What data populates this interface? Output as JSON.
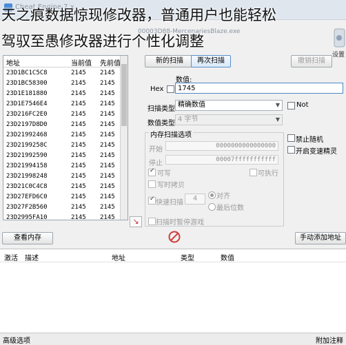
{
  "caption": {
    "line1": "天之痕数据惊现修改器，普通用户也能轻松",
    "line2": "驾驭至愚修改器进行个性化调整"
  },
  "window": {
    "app_title": "Cheat Engine 7.x",
    "process_title": "00003D88-MercenariesBlaze.exe"
  },
  "address_list": {
    "headers": [
      "地址",
      "当前值",
      "先前值"
    ],
    "rows": [
      {
        "address": "23D1BC1C5C8",
        "current": "2145",
        "previous": "2145"
      },
      {
        "address": "23D1BC58300",
        "current": "2145",
        "previous": "2145"
      },
      {
        "address": "23D1E181880",
        "current": "2145",
        "previous": "2145"
      },
      {
        "address": "23D1E7546E4",
        "current": "2145",
        "previous": "2145"
      },
      {
        "address": "23D216FC2E0",
        "current": "2145",
        "previous": "2145"
      },
      {
        "address": "23D2197D8D0",
        "current": "2145",
        "previous": "2145"
      },
      {
        "address": "23D21992468",
        "current": "2145",
        "previous": "2145"
      },
      {
        "address": "23D2199258C",
        "current": "2145",
        "previous": "2145"
      },
      {
        "address": "23D21992590",
        "current": "2145",
        "previous": "2145"
      },
      {
        "address": "23D21994158",
        "current": "2145",
        "previous": "2145"
      },
      {
        "address": "23D21998248",
        "current": "2145",
        "previous": "2145"
      },
      {
        "address": "23D21C0C4C8",
        "current": "2145",
        "previous": "2145"
      },
      {
        "address": "23D27EFD6C0",
        "current": "2145",
        "previous": "2145"
      },
      {
        "address": "23D27F2B560",
        "current": "2145",
        "previous": "2145"
      },
      {
        "address": "23D2995FA10",
        "current": "2145",
        "previous": "2145"
      }
    ]
  },
  "scan": {
    "new_scan": "新的扫描",
    "next_scan": "再次扫描",
    "undo_scan": "撤销扫描",
    "settings": "设置",
    "value_label": "数值:",
    "hex_label": "Hex",
    "value": "1745",
    "scan_type_label": "扫描类型",
    "scan_type": "精确数值",
    "value_type_label": "数值类型",
    "value_type": "4 字节",
    "not_label": "Not",
    "no_random": "禁止随机",
    "speedhack": "开启变速精灵"
  },
  "memory_options": {
    "title": "内存扫描选项",
    "start_label": "开始",
    "start_value": "0000000000000000",
    "stop_label": "停止",
    "stop_value": "00007fffffffffff",
    "writable": "可写",
    "executable": "可执行",
    "copy_on_write": "写时拷贝",
    "fast_scan": "快速扫描",
    "fast_scan_value": "4",
    "align": "对齐",
    "last_digits": "最后位数",
    "pause_game": "扫描时暂停游戏"
  },
  "toolbar": {
    "view_memory": "查看内存",
    "manual_add": "手动添加地址"
  },
  "cheat_table": {
    "headers": [
      "激活",
      "描述",
      "地址",
      "类型",
      "数值"
    ]
  },
  "status": {
    "advanced": "高级选项",
    "add_notes": "附加注释"
  },
  "colors": {
    "accent": "#4f86c6",
    "stop_icon": "#d23a3a"
  }
}
